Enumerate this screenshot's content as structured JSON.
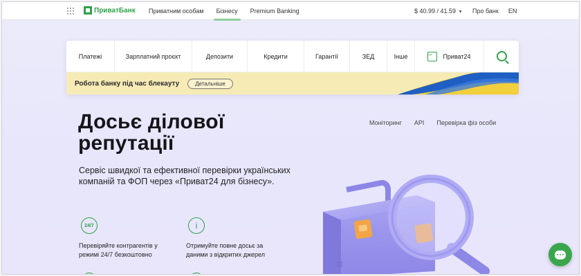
{
  "topbar": {
    "logo": "ПриватБанк",
    "nav": [
      "Приватним особам",
      "Бізнесу",
      "Premium Banking"
    ],
    "active_nav": "Бізнесу",
    "rates": "$ 40.99 / 41.59",
    "about": "Про банк",
    "lang": "EN"
  },
  "menu": {
    "items": [
      "Платежі",
      "Зарплатний проєкт",
      "Депозити",
      "Кредити",
      "Гарантії",
      "ЗЕД",
      "Інше"
    ],
    "privat24": "Приват24"
  },
  "notice": {
    "text": "Робота банку під час блекауту",
    "button": "Детальніше"
  },
  "hero": {
    "title_line1": "Досьє ділової",
    "title_line2": "репутації",
    "subtitle": "Сервіс швидкої та ефективної перевірки українських компаній та ФОП через «Приват24 для бізнесу».",
    "links": [
      "Моніторинг",
      "API",
      "Перевірка фіз особи"
    ]
  },
  "features": [
    {
      "icon_label": "24/7",
      "line1": "Перевіряйте контрагентів у",
      "line2": "режимі 24/7 безкоштовно"
    },
    {
      "icon_label": "i",
      "line1": "Отримуйте повне досьє за",
      "line2": "даними з відкритих джерел"
    }
  ],
  "colors": {
    "brand_green": "#2fa14a",
    "notice_bg": "#f6ebb5",
    "hero_bg": "#ebe9fb"
  }
}
